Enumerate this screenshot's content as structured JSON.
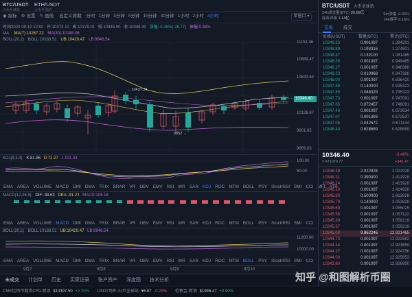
{
  "app": {
    "pair": "BTC/USDT",
    "pair_sub": "火币全球站",
    "pair2": "ETH/USDT",
    "pair2_sub": "火币全球站"
  },
  "toolbar": {
    "items": [
      "指标",
      "设置",
      "画线",
      "自定义周期"
    ],
    "periods": [
      "分时",
      "1分钟",
      "3分钟",
      "5分钟",
      "15分钟",
      "30分钟",
      "1小时",
      "2小时",
      "4小时"
    ],
    "active_period": "4小时",
    "window_btn": "单窗口"
  },
  "chart_info": {
    "time": "时间2020-09-10 12:00",
    "open": "开:10373.10",
    "high": "高:10379.01",
    "low": "低:10345.00",
    "close": "收:10346.40",
    "change": "涨幅:-0.26%(-26.77)",
    "amplitude": "振幅:0.33%",
    "ma_label": "MA",
    "ma7": "MA(7):10267.22",
    "ma30": "MA(30):10188.06",
    "boll_label": "BOLL(20,2)",
    "boll_val": "BOLL:10183.51",
    "ub": "UB:10420.47",
    "lb": "LB:9946.54"
  },
  "price_axis": [
    "11151.46",
    "10889.47",
    "10633.64",
    "10346.40",
    "10139.87",
    "9901.65",
    "9669.03"
  ],
  "annotations": {
    "high": "10437.34",
    "low": "9852"
  },
  "kdj": {
    "label": "KDJ(9,3,3)",
    "k": "K:81.96",
    "d": "D:72.27",
    "j": "J:101.33",
    "axis": [
      "100.00",
      "50.00"
    ]
  },
  "macd": {
    "label": "MACD(12,26,9)",
    "dif": "DIF:-38.63",
    "dea": "DEA:-91.22",
    "macd": "MACD:105.18"
  },
  "boll2": {
    "label": "BOLL(20,2)",
    "boll": "BOLL:10183.51",
    "ub": "UB:10420.47",
    "lb": "LB:9946.54",
    "axis": [
      "11000.00",
      "10000.00"
    ]
  },
  "indicator_rows": {
    "row1": [
      "EMA",
      "AREA",
      "VOLUME",
      "MACD",
      "DMI",
      "DMA",
      "TRIX",
      "BRAR",
      "VR",
      "OBV",
      "EMV",
      "RSI",
      "WR",
      "SAR",
      "KDJ",
      "ROC",
      "MTM",
      "BOLL",
      "PSY",
      "StochRSI",
      "SMI",
      "CCI",
      "MFI",
      "ATR"
    ],
    "row1_active": "KDJ",
    "row2": [
      "EMA",
      "AREA",
      "VOLUME",
      "MACD",
      "DMI",
      "DMA",
      "TRIX",
      "BRAR",
      "VR",
      "OBV",
      "EMV",
      "RSI",
      "WR",
      "SAR",
      "KDJ",
      "ROC",
      "MTM",
      "BOLL",
      "PSY",
      "StochRSI",
      "SMI",
      "CCI"
    ],
    "row2_active": "MACD",
    "row3": [
      "EMA",
      "AREA",
      "VOLUME",
      "MACD",
      "DMI",
      "DMA",
      "TRIX",
      "BRAR",
      "VR",
      "OBV",
      "EMV",
      "RSI",
      "WR",
      "SAR",
      "KDJ",
      "ROC",
      "MTM",
      "BOLL",
      "PSY",
      "StochRSI",
      "SMI",
      "CCI"
    ],
    "row3_active": "BOLL"
  },
  "x_axis": [
    "9月7",
    "9月8",
    "9月9",
    "9月10"
  ],
  "bottom_tabs": [
    "未成交",
    "计划单",
    "历史",
    "买家记录",
    "账户资产",
    "深度图",
    "技术分析"
  ],
  "ticker": {
    "i1_name": "CME比特币期货CFD-新浪",
    "i1_val": "$10397.50",
    "i1_chg": "+2.70%",
    "i2_name": "USDT场外-火币全球站",
    "i2_val": "¥6.87",
    "i2_chg": "-0.29%",
    "i3_name": "伦敦金-新浪",
    "i3_val": "$1946.47",
    "i3_chg": "+0.90%"
  },
  "right_panel": {
    "title": "BTC/USDT",
    "exchange": "火币全球站",
    "stats_l1": "24h成交量(BTC)",
    "stats_l2": "20.69亿",
    "stats_r1": "5m涨幅 -0.06%",
    "stats_r2": "24h换手 0.16%",
    "rank_label": "综合评级",
    "rank_val": "1.14亿",
    "tab_trades": "交易",
    "tab_deals": "成交",
    "col_price": "价格(USDT)",
    "col_amount": "数量(BTC)",
    "col_total": "累计(BTC)",
    "current_price": "10346.40",
    "current_change": "-3.46%",
    "current_cny": "≈ ¥71079.77",
    "current_diff": "+345.47"
  },
  "asks": [
    [
      "10349.33",
      "0.001097",
      "1.284201"
    ],
    [
      "10348.89",
      "0.193316",
      "1.274801"
    ],
    [
      "10348.87",
      "0.132100",
      "1.081485"
    ],
    [
      "10348.35",
      "0.001097",
      "0.949485"
    ],
    [
      "10348.27",
      "0.001097",
      "0.948388"
    ],
    [
      "10348.23",
      "0.010968",
      "0.947388"
    ],
    [
      "10348.00",
      "0.001097",
      "0.936420"
    ],
    [
      "10347.89",
      "0.140000",
      "0.935323"
    ],
    [
      "10347.85",
      "0.048329",
      "0.795323"
    ],
    [
      "10347.73",
      "0.001097",
      "0.747091"
    ],
    [
      "10347.65",
      "0.072457",
      "0.746091"
    ],
    [
      "10347.40",
      "0.001097",
      "0.673634"
    ],
    [
      "10347.07",
      "0.001393",
      "0.672537"
    ],
    [
      "10347.06",
      "0.042572",
      "0.671144"
    ],
    [
      "10346.40",
      "0.628669",
      "0.628669"
    ]
  ],
  "bids": [
    [
      "10346.39",
      "2.022928",
      "2.022928"
    ],
    [
      "10346.31",
      "0.390000",
      "2.412928"
    ],
    [
      "10346.24",
      "0.001097",
      "2.413928"
    ],
    [
      "10346.10",
      "0.001097",
      "2.414928"
    ],
    [
      "10345.80",
      "0.500000",
      "2.913928"
    ],
    [
      "10345.79",
      "0.140000",
      "3.053928"
    ],
    [
      "10345.69",
      "0.001097",
      "3.055025"
    ],
    [
      "10345.55",
      "0.001097",
      "3.057122"
    ],
    [
      "10345.39",
      "0.001097",
      "3.058219"
    ],
    [
      "10345.37",
      "0.001097",
      "3.059219"
    ],
    [
      "10345.00",
      "9.862246",
      "12.921465"
    ],
    [
      "10344.73",
      "0.001097",
      "12.922562"
    ],
    [
      "10344.44",
      "0.001097",
      "12.923659"
    ],
    [
      "10344.27",
      "0.001097",
      "12.924756"
    ],
    [
      "10344.00",
      "0.001097",
      "12.925853"
    ],
    [
      "10343.80",
      "0.001097",
      "12.926950"
    ]
  ],
  "watermark": "知乎 @和图解析币圈",
  "colors": {
    "up": "#26a69a",
    "down": "#e0556b",
    "accent": "#3d7bff",
    "bg": "#131a26",
    "ma7": "#e6c65a",
    "ma30": "#c264d9"
  }
}
